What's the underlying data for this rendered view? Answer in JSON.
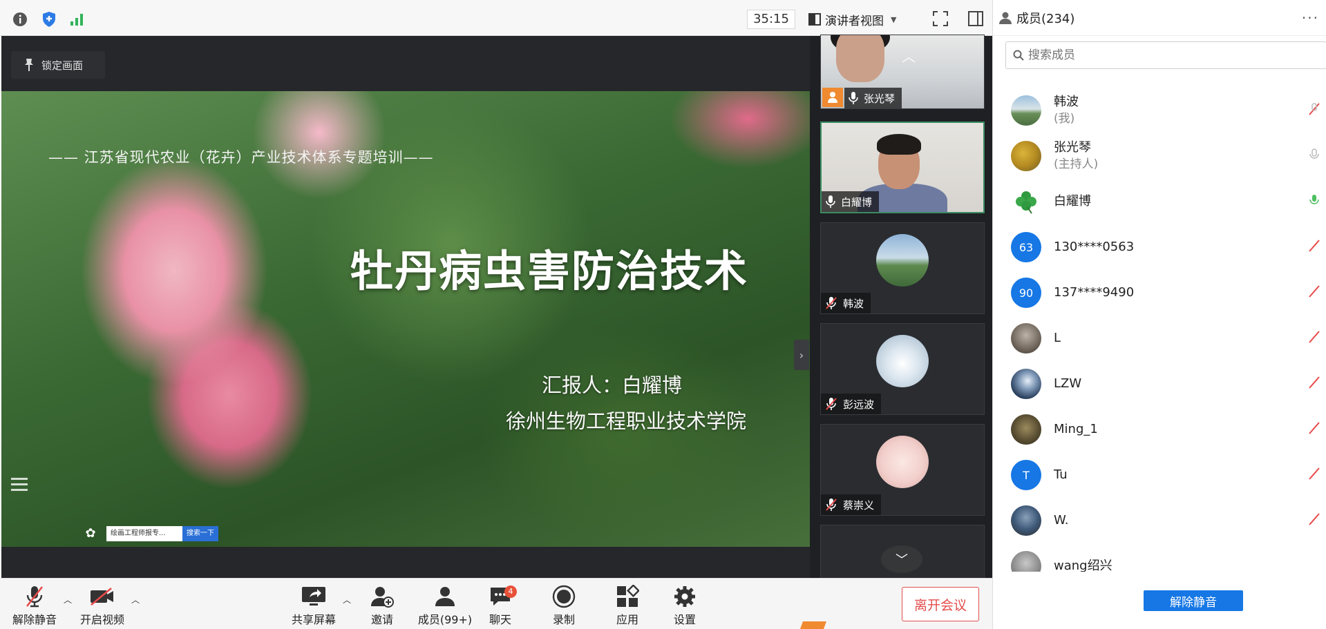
{
  "topbar": {
    "timer": "35:15",
    "view_label": "演讲者视图"
  },
  "stage": {
    "lock_label": "锁定画面",
    "slide": {
      "subtitle": "—— 江苏省现代农业（花卉）产业技术体系专题培训——",
      "title": "牡丹病虫害防治技术",
      "reporter": "汇报人：白耀博",
      "school": "徐州生物工程职业技术学院",
      "taskbar_text": "绘画工程师报专...",
      "taskbar_button": "搜索一下"
    }
  },
  "videos": [
    {
      "name": "张光琴",
      "kind": "video"
    },
    {
      "name": "白耀博",
      "kind": "video"
    },
    {
      "name": "韩波",
      "kind": "avatar"
    },
    {
      "name": "彭远波",
      "kind": "avatar"
    },
    {
      "name": "蔡崇义",
      "kind": "avatar"
    }
  ],
  "toolbar": {
    "unmute": "解除静音",
    "start_video": "开启视频",
    "share_screen": "共享屏幕",
    "invite": "邀请",
    "members": "成员(99+)",
    "chat": "聊天",
    "chat_badge": "4",
    "record": "录制",
    "apps": "应用",
    "settings": "设置",
    "leave": "离开会议"
  },
  "members_panel": {
    "title": "成员(234)",
    "search_placeholder": "搜索成员",
    "items": [
      {
        "name": "韩波",
        "sub": "(我)",
        "avatar": "photo-lake"
      },
      {
        "name": "张光琴",
        "sub": "(主持人)",
        "avatar": "photo-flowers"
      },
      {
        "name": "白耀博",
        "sub": "",
        "avatar": "clover"
      },
      {
        "name": "130****0563",
        "sub": "",
        "avatar": "63"
      },
      {
        "name": "137****9490",
        "sub": "",
        "avatar": "90"
      },
      {
        "name": "L",
        "sub": "",
        "avatar": "photo"
      },
      {
        "name": "LZW",
        "sub": "",
        "avatar": "photo-moon"
      },
      {
        "name": "Ming_1",
        "sub": "",
        "avatar": "photo"
      },
      {
        "name": "Tu",
        "sub": "",
        "avatar": "T"
      },
      {
        "name": "W.",
        "sub": "",
        "avatar": "photo"
      },
      {
        "name": "wang绍兴",
        "sub": "",
        "avatar": "photo"
      }
    ],
    "unmute_all": "解除静音"
  },
  "colors": {
    "accent_blue": "#1677e5",
    "leave_red": "#e34d4d",
    "stage_bg": "#25272a"
  }
}
